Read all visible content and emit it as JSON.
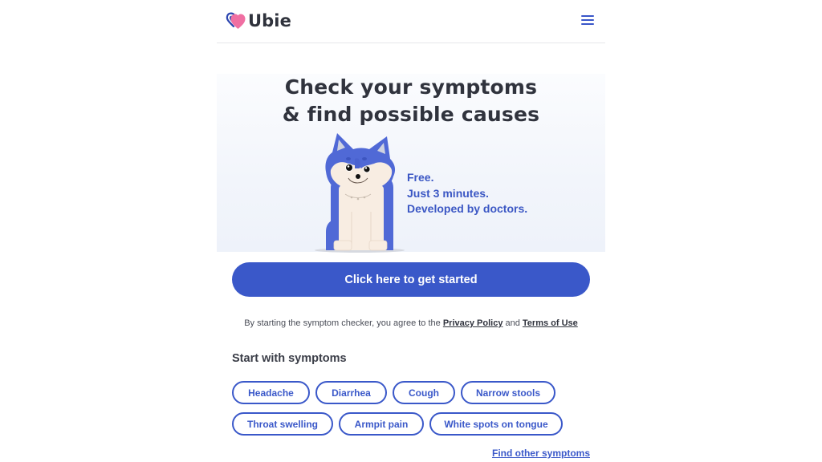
{
  "header": {
    "brand": "Ubie",
    "logo_icon": "heart-logo-icon",
    "menu_icon": "hamburger-menu-icon"
  },
  "hero": {
    "title_line1": "Check your symptoms",
    "title_line2": "& find possible causes",
    "mascot": "dog-mascot-illustration",
    "taglines": [
      "Free.",
      "Just 3 minutes.",
      "Developed by doctors."
    ]
  },
  "cta": {
    "label": "Click here to get started"
  },
  "consent": {
    "prefix": "By starting the symptom checker, you agree to the ",
    "privacy_label": "Privacy Policy",
    "middle": " and ",
    "terms_label": "Terms of Use"
  },
  "symptoms": {
    "title": "Start with symptoms",
    "rows": [
      [
        "Headache",
        "Diarrhea",
        "Cough",
        "Narrow stools"
      ],
      [
        "Throat swelling",
        "Armpit pain",
        "White spots on tongue"
      ]
    ],
    "find_other_label": "Find other symptoms"
  },
  "colors": {
    "primary": "#3a58c9",
    "logo_pink": "#f06fa2",
    "logo_navy": "#2c46b0",
    "text_dark": "#30333d"
  }
}
